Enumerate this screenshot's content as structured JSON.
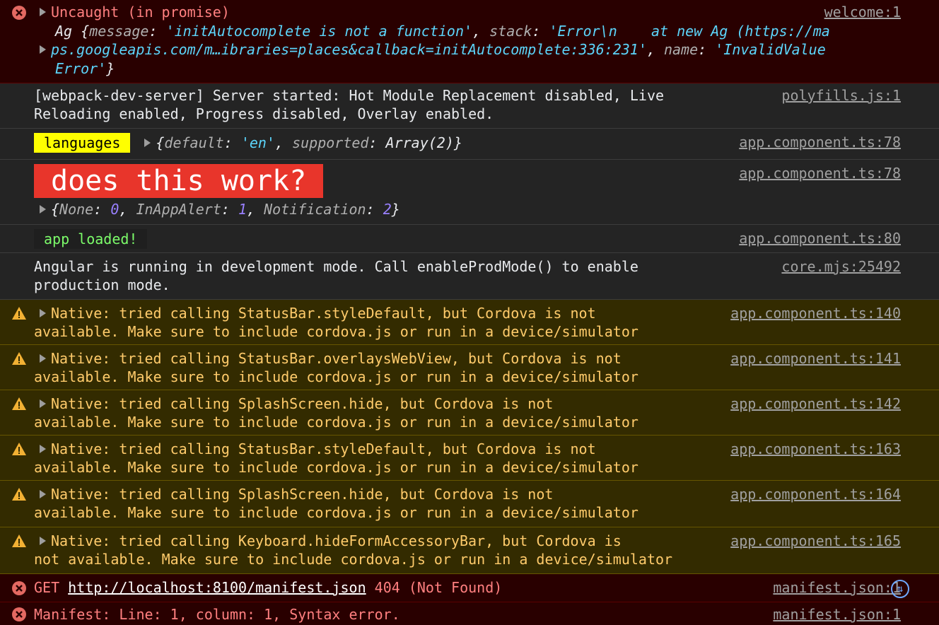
{
  "colors": {
    "error_bg": "#290000",
    "warning_bg": "#332b00",
    "log_bg": "#242424",
    "string": "#5cd5fb",
    "number": "#9980ff",
    "link": "#a0a0a0"
  },
  "uncaught": {
    "title": "Uncaught (in promise)",
    "source": "welcome:1",
    "obj_name": "Ag",
    "k_message": "message",
    "v_message": "'initAutocomplete is not a function'",
    "k_stack": "stack",
    "v_stack_1": "'Error\\n    at new Ag (https://ma",
    "v_stack_2": "ps.googleapis.com/m…ibraries=places&callback=initAutocomplete:336:231'",
    "k_name": "name",
    "v_name_1": "'InvalidValue",
    "v_name_2": "Error'"
  },
  "webpack": {
    "line1": "[webpack-dev-server] Server started: Hot Module Replacement disabled, Live",
    "line2": "Reloading enabled, Progress disabled, Overlay enabled.",
    "source": "polyfills.js:1"
  },
  "languages": {
    "badge": "languages",
    "k_default": "default",
    "v_default": "'en'",
    "k_supported": "supported",
    "v_supported": "Array(2)",
    "source": "app.component.ts:78"
  },
  "works": {
    "badge": "does this work?",
    "k_none": "None",
    "v_none": "0",
    "k_inapp": "InAppAlert",
    "v_inapp": "1",
    "k_notif": "Notification",
    "v_notif": "2",
    "source": "app.component.ts:78"
  },
  "loaded": {
    "badge": "app loaded!",
    "source": "app.component.ts:80"
  },
  "angular": {
    "line1": "Angular is running in development mode. Call enableProdMode() to enable",
    "line2": "production mode.",
    "source": "core.mjs:25492"
  },
  "warnings": [
    {
      "line1": "Native: tried calling StatusBar.styleDefault, but Cordova is not",
      "line2": "available. Make sure to include cordova.js or run in a device/simulator",
      "source": "app.component.ts:140"
    },
    {
      "line1": "Native: tried calling StatusBar.overlaysWebView, but Cordova is not",
      "line2": "available. Make sure to include cordova.js or run in a device/simulator",
      "source": "app.component.ts:141"
    },
    {
      "line1": "Native: tried calling SplashScreen.hide, but Cordova is not",
      "line2": "available. Make sure to include cordova.js or run in a device/simulator",
      "source": "app.component.ts:142"
    },
    {
      "line1": "Native: tried calling StatusBar.styleDefault, but Cordova is not",
      "line2": "available. Make sure to include cordova.js or run in a device/simulator",
      "source": "app.component.ts:163"
    },
    {
      "line1": "Native: tried calling SplashScreen.hide, but Cordova is not",
      "line2": "available. Make sure to include cordova.js or run in a device/simulator",
      "source": "app.component.ts:164"
    },
    {
      "line1": "Native: tried calling Keyboard.hideFormAccessoryBar, but Cordova is",
      "line2": "not available. Make sure to include cordova.js or run in a device/simulator",
      "source": "app.component.ts:165"
    }
  ],
  "get_error": {
    "method": "GET",
    "url": "http://localhost:8100/manifest.json",
    "status": "404 (Not Found)",
    "source": "manifest.json:1",
    "icon": "network-request-icon"
  },
  "manifest_error": {
    "text": "Manifest: Line: 1, column: 1, Syntax error.",
    "source": "manifest.json:1"
  }
}
